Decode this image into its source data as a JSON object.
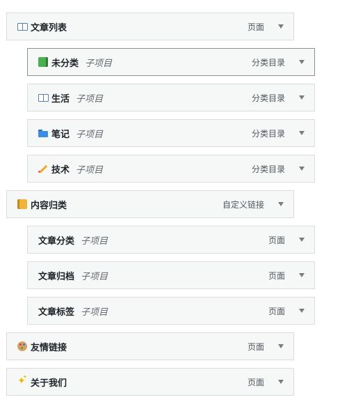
{
  "menu": {
    "items": [
      {
        "label": "文章列表",
        "subtag": "",
        "type": "页面",
        "icon": "open-book-icon",
        "depth": 0
      },
      {
        "label": "未分类",
        "subtag": "子项目",
        "type": "分类目录",
        "icon": "green-book-icon",
        "depth": 1
      },
      {
        "label": "生活",
        "subtag": "子项目",
        "type": "分类目录",
        "icon": "open-book-icon",
        "depth": 1
      },
      {
        "label": "笔记",
        "subtag": "子项目",
        "type": "分类目录",
        "icon": "folder-icon",
        "depth": 1
      },
      {
        "label": "技术",
        "subtag": "子项目",
        "type": "分类目录",
        "icon": "pencil-icon",
        "depth": 1
      },
      {
        "label": "内容归类",
        "subtag": "",
        "type": "自定义链接",
        "icon": "notebook-icon",
        "depth": 0
      },
      {
        "label": "文章分类",
        "subtag": "子项目",
        "type": "页面",
        "icon": "",
        "depth": 1
      },
      {
        "label": "文章归档",
        "subtag": "子项目",
        "type": "页面",
        "icon": "",
        "depth": 1
      },
      {
        "label": "文章标签",
        "subtag": "子项目",
        "type": "页面",
        "icon": "",
        "depth": 1
      },
      {
        "label": "友情链接",
        "subtag": "",
        "type": "页面",
        "icon": "palette-icon",
        "depth": 0
      },
      {
        "label": "关于我们",
        "subtag": "",
        "type": "页面",
        "icon": "sparkles-icon",
        "depth": 0
      }
    ]
  }
}
